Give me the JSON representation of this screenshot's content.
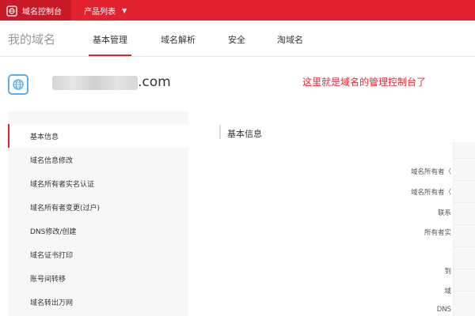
{
  "topbar": {
    "brand_label": "域名控制台",
    "product_menu_label": "产品列表"
  },
  "nav": {
    "page_title": "我的域名",
    "tabs": [
      {
        "label": "基本管理"
      },
      {
        "label": "域名解析"
      },
      {
        "label": "安全"
      },
      {
        "label": "淘域名"
      }
    ]
  },
  "domain": {
    "suffix": ".com",
    "annotation": "这里就是域名的管理控制台了"
  },
  "sidebar": {
    "items": [
      {
        "label": "基本信息"
      },
      {
        "label": "域名信息修改"
      },
      {
        "label": "域名所有者实名认证"
      },
      {
        "label": "域名所有者变更(过户)"
      },
      {
        "label": "DNS修改/创建"
      },
      {
        "label": "域名证书打印"
      },
      {
        "label": "账号间转移"
      },
      {
        "label": "域名转出万网"
      }
    ]
  },
  "content": {
    "section_title": "基本信息",
    "field_labels": [
      "域名所有者（",
      "域名所有者（",
      "联系",
      "所有者实",
      "",
      "到",
      "域",
      "DNS"
    ]
  },
  "colors": {
    "brand_red": "#e3222f",
    "annotation_red": "#f0262f",
    "icon_blue": "#5bb0ea"
  }
}
